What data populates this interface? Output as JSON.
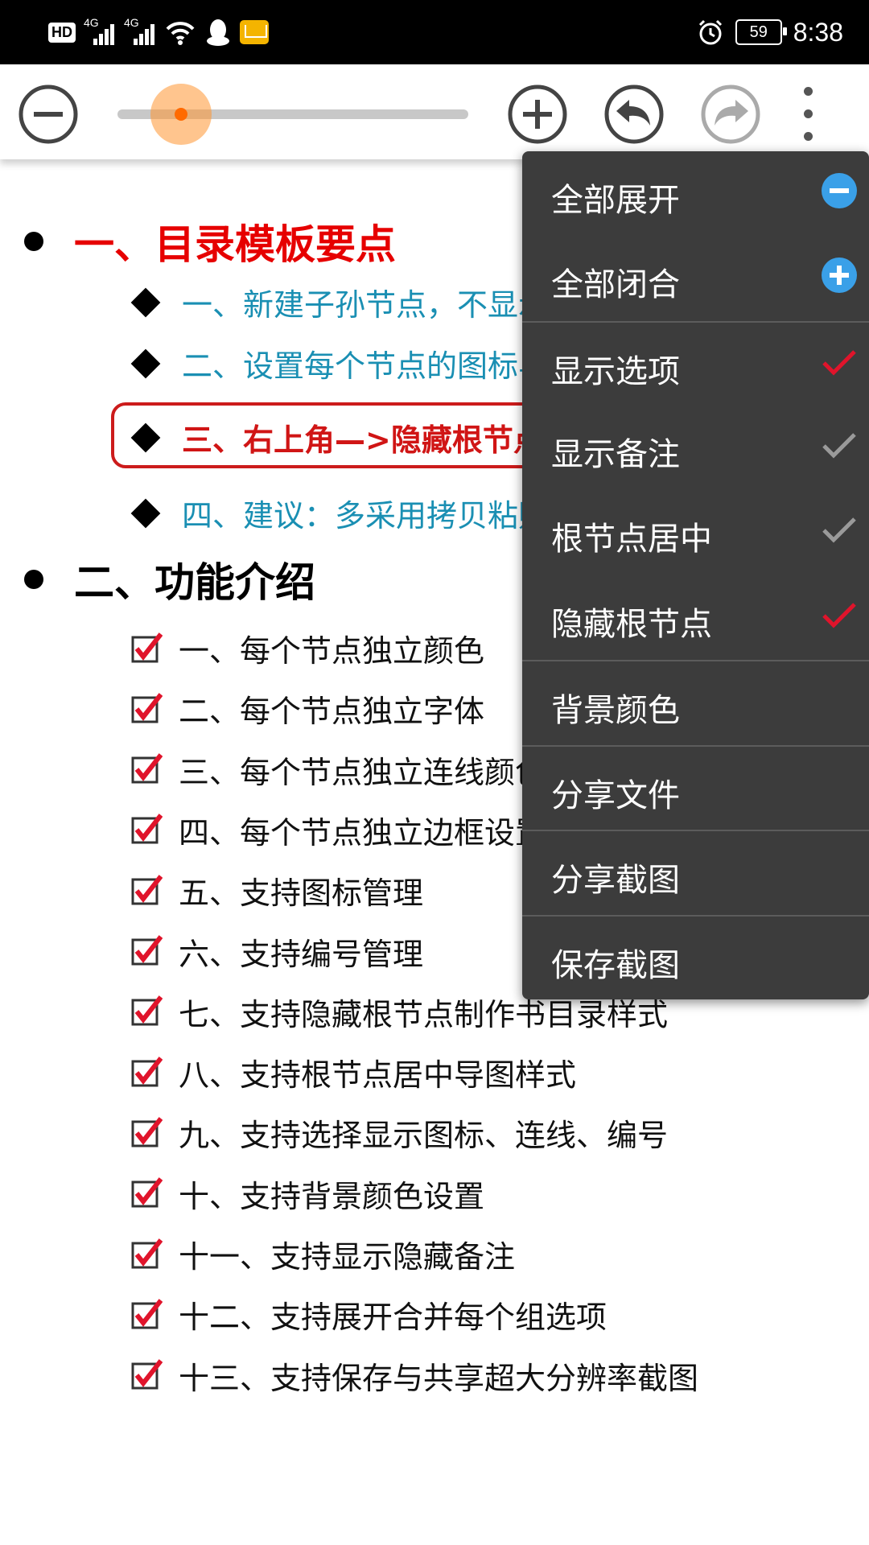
{
  "status_bar": {
    "hd_label": "HD",
    "signal1_label": "4G",
    "signal2_label": "4G",
    "battery_level": "59",
    "time": "8:38"
  },
  "toolbar": {
    "zoom_level_fraction": 0.08
  },
  "colors": {
    "root1": "#e60000",
    "teal": "#1a8fb3",
    "highlight": "#d01515",
    "menu_bg": "#3c3c3c",
    "check_red": "#e0142b",
    "check_gray": "#9a9a9a",
    "info_blue": "#3aa0e8"
  },
  "tree": {
    "root1": "一、目录模板要点",
    "root1_children": [
      "一、新建子孙节点，不显示连线",
      "二、设置每个节点的图标与连线",
      "三、右上角—>隐藏根节点",
      "四、建议：多采用拷贝粘贴更便捷"
    ],
    "root2": "二、功能介绍",
    "root2_children": [
      "一、每个节点独立颜色",
      "二、每个节点独立字体",
      "三、每个节点独立连线颜色、长度、高度",
      "四、每个节点独立边框设置",
      "五、支持图标管理",
      "六、支持编号管理",
      "七、支持隐藏根节点制作书目录样式",
      "八、支持根节点居中导图样式",
      "九、支持选择显示图标、连线、编号",
      "十、支持背景颜色设置",
      "十一、支持显示隐藏备注",
      "十二、支持展开合并每个组选项",
      "十三、支持保存与共享超大分辨率截图"
    ]
  },
  "menu": {
    "items": [
      {
        "label": "全部展开",
        "icon": "collapse-minus-icon"
      },
      {
        "label": "全部闭合",
        "icon": "expand-plus-icon"
      },
      {
        "label": "显示选项",
        "icon": "check-icon",
        "checked": true
      },
      {
        "label": "显示备注",
        "icon": "check-icon",
        "checked": false
      },
      {
        "label": "根节点居中",
        "icon": "check-icon",
        "checked": false
      },
      {
        "label": "隐藏根节点",
        "icon": "check-icon",
        "checked": true
      },
      {
        "label": "背景颜色",
        "icon": ""
      },
      {
        "label": "分享文件",
        "icon": ""
      },
      {
        "label": "分享截图",
        "icon": ""
      },
      {
        "label": "保存截图",
        "icon": ""
      }
    ]
  }
}
